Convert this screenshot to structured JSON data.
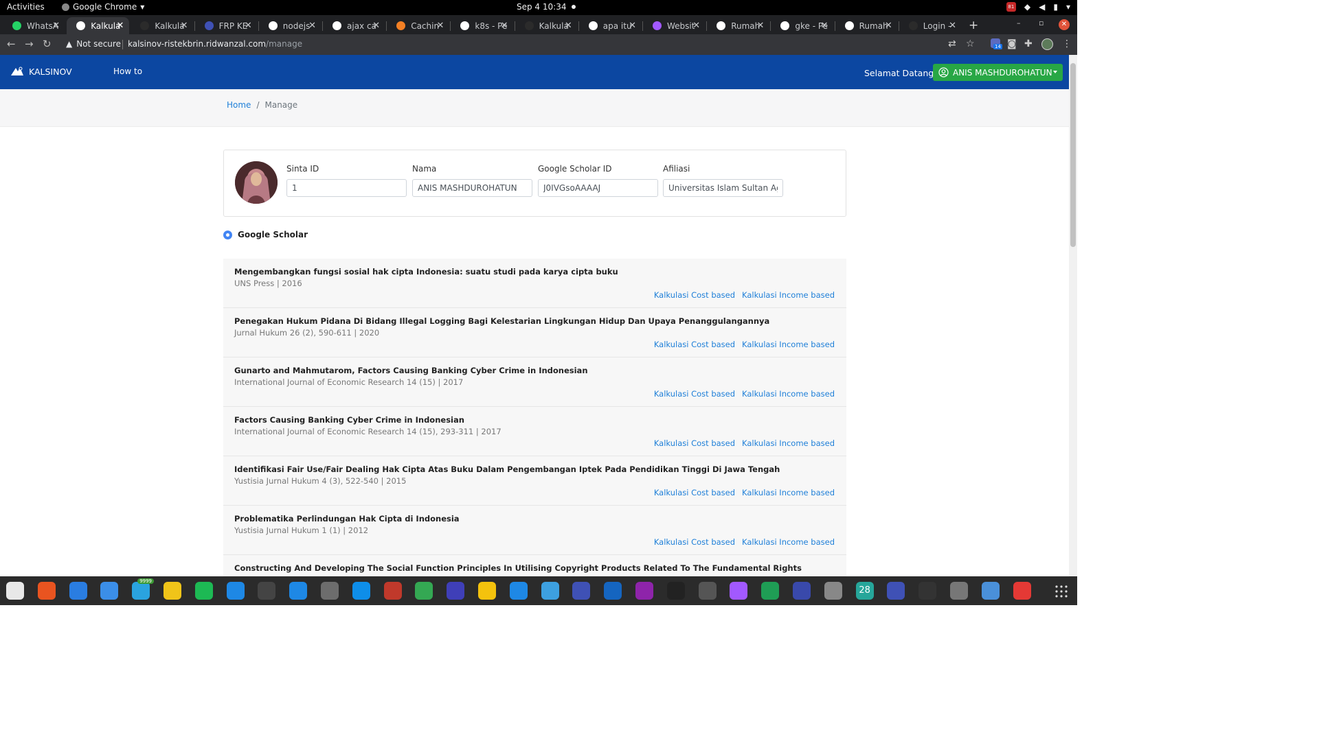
{
  "system_bar": {
    "activities": "Activities",
    "app_menu": "Google Chrome",
    "clock": "Sep 4  10:34",
    "tray_badge": "81"
  },
  "tabs": [
    {
      "title": "WhatsA",
      "active": false,
      "favicon": "whatsapp-icon",
      "color": "#25d366"
    },
    {
      "title": "Kalkula",
      "active": true,
      "favicon": "globe-icon",
      "color": "#ffffff"
    },
    {
      "title": "Kalkula",
      "active": false,
      "favicon": "github-icon",
      "color": "#2b2b2b"
    },
    {
      "title": "FRP KE",
      "active": false,
      "favicon": "chart-icon",
      "color": "#3f51b5"
    },
    {
      "title": "nodejs",
      "active": false,
      "favicon": "google-icon",
      "color": "#ffffff"
    },
    {
      "title": "ajax ca",
      "active": false,
      "favicon": "google-icon",
      "color": "#ffffff"
    },
    {
      "title": "Cachin",
      "active": false,
      "favicon": "stackoverflow-icon",
      "color": "#f48024"
    },
    {
      "title": "k8s - Pe",
      "active": false,
      "favicon": "google-icon",
      "color": "#ffffff"
    },
    {
      "title": "Kalkula",
      "active": false,
      "favicon": "github-icon",
      "color": "#2b2b2b"
    },
    {
      "title": "apa itu",
      "active": false,
      "favicon": "google-icon",
      "color": "#ffffff"
    },
    {
      "title": "Websit",
      "active": false,
      "favicon": "figma-icon",
      "color": "#a259ff"
    },
    {
      "title": "Rumah",
      "active": false,
      "favicon": "wiki-icon",
      "color": "#ffffff"
    },
    {
      "title": "gke - Pe",
      "active": false,
      "favicon": "google-icon",
      "color": "#ffffff"
    },
    {
      "title": "Rumah",
      "active": false,
      "favicon": "wiki-icon",
      "color": "#ffffff"
    },
    {
      "title": "Login -",
      "active": false,
      "favicon": "github-icon",
      "color": "#2b2b2b"
    }
  ],
  "omnibox": {
    "security": "Not secure",
    "host": "kalsinov-ristekbrin.ridwanzal.com",
    "path": "/manage",
    "extension_badge": "14"
  },
  "navbar": {
    "brand": "KALSINOV",
    "how_to": "How to",
    "welcome": "Selamat Datang,",
    "user": "ANIS MASHDUROHATUN",
    "bg_color": "#0c47a1",
    "user_btn_color": "#28a745"
  },
  "breadcrumb": {
    "home": "Home",
    "separator": "/",
    "current": "Manage"
  },
  "profile": {
    "sinta_label": "Sinta ID",
    "sinta_value": "1",
    "nama_label": "Nama",
    "nama_value": "ANIS MASHDUROHATUN",
    "scholar_label": "Google Scholar ID",
    "scholar_value": "J0IVGsoAAAAJ",
    "afiliasi_label": "Afiliasi",
    "afiliasi_value": "Universitas Islam Sultan Agung"
  },
  "scholar_section": {
    "heading": "Google Scholar"
  },
  "publications": [
    {
      "title": "Mengembangkan fungsi sosial hak cipta Indonesia: suatu studi pada karya cipta buku",
      "meta": "UNS Press | 2016"
    },
    {
      "title": "Penegakan Hukum Pidana Di Bidang Illegal Logging Bagi Kelestarian Lingkungan Hidup Dan Upaya Penanggulangannya",
      "meta": "Jurnal Hukum 26 (2), 590-611 | 2020"
    },
    {
      "title": "Gunarto and Mahmutarom, Factors Causing Banking Cyber Crime in Indonesian",
      "meta": "International Journal of Economic Research 14 (15) | 2017"
    },
    {
      "title": "Factors Causing Banking Cyber Crime in Indonesian",
      "meta": "International Journal of Economic Research 14 (15), 293-311 | 2017"
    },
    {
      "title": "Identifikasi Fair Use/Fair Dealing Hak Cipta Atas Buku Dalam Pengembangan Iptek Pada Pendidikan Tinggi Di Jawa Tengah",
      "meta": "Yustisia Jurnal Hukum 4 (3), 522-540 | 2015"
    },
    {
      "title": "Problematika Perlindungan Hak Cipta di Indonesia",
      "meta": "Yustisia Jurnal Hukum 1 (1) | 2012"
    },
    {
      "title": "Constructing And Developing The Social Function Principles In Utilising Copyright Products Related To The Fundamental Rights",
      "meta": ""
    }
  ],
  "actions": {
    "cost": "Kalkulasi Cost based",
    "income": "Kalkulasi Income based"
  },
  "dock": {
    "telegram_badge": "9999",
    "calendar_day": "28",
    "apps": [
      {
        "name": "files-icon",
        "color": "#e8e8e8"
      },
      {
        "name": "software-center-icon",
        "color": "#e95420"
      },
      {
        "name": "network-icon",
        "color": "#2a7de1"
      },
      {
        "name": "thunderbird-icon",
        "color": "#3b8ee8"
      },
      {
        "name": "telegram-icon",
        "color": "#2aa3df"
      },
      {
        "name": "rhythmbox-icon",
        "color": "#f0c419"
      },
      {
        "name": "spotify-icon",
        "color": "#1db954"
      },
      {
        "name": "writer-icon",
        "color": "#1e88e5"
      },
      {
        "name": "system-monitor-icon",
        "color": "#444444"
      },
      {
        "name": "vscode-icon",
        "color": "#1e88e5"
      },
      {
        "name": "gimp-icon",
        "color": "#6d6d6d"
      },
      {
        "name": "teamviewer-icon",
        "color": "#0e8ee9"
      },
      {
        "name": "library-icon",
        "color": "#c0392b"
      },
      {
        "name": "chrome-icon",
        "color": "#34a853"
      },
      {
        "name": "eclipse-icon",
        "color": "#3f3fb8"
      },
      {
        "name": "bucket-icon",
        "color": "#f4c20d"
      },
      {
        "name": "help-icon",
        "color": "#1e88e5"
      },
      {
        "name": "code-editor-icon",
        "color": "#3da0e0"
      },
      {
        "name": "settings-app-icon",
        "color": "#3f51b5"
      },
      {
        "name": "simplenote-icon",
        "color": "#1565c0"
      },
      {
        "name": "firefox-dev-icon",
        "color": "#8e24aa"
      },
      {
        "name": "inkscape-icon",
        "color": "#222222"
      },
      {
        "name": "bug-icon",
        "color": "#555555"
      },
      {
        "name": "figma-icon",
        "color": "#a259ff"
      },
      {
        "name": "sheets-icon",
        "color": "#1f9d55"
      },
      {
        "name": "package-icon",
        "color": "#3949ab"
      },
      {
        "name": "disk-icon",
        "color": "#888888"
      },
      {
        "name": "calendar-icon",
        "color": "#26a69a"
      },
      {
        "name": "screenshot-icon",
        "color": "#3f51b5"
      },
      {
        "name": "terminal-icon",
        "color": "#333333"
      },
      {
        "name": "gear-icon",
        "color": "#777777"
      },
      {
        "name": "text-editor-icon",
        "color": "#4a90d9"
      },
      {
        "name": "alert-icon",
        "color": "#e53935"
      }
    ]
  }
}
